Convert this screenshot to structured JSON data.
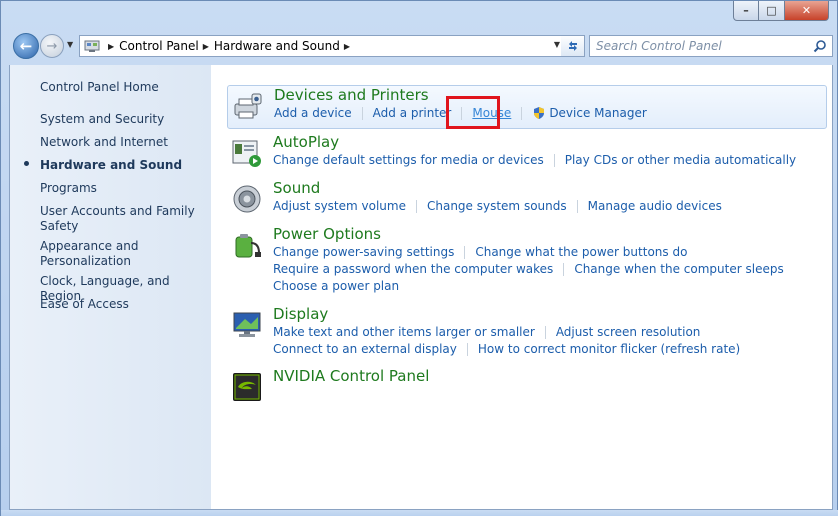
{
  "window": {
    "minimize_label": "–",
    "maximize_label": "□",
    "close_label": "✕"
  },
  "toolbar": {
    "back_glyph": "←",
    "forward_glyph": "→",
    "breadcrumbs": [
      "Control Panel",
      "Hardware and Sound"
    ],
    "search_placeholder": "Search Control Panel"
  },
  "sidebar": {
    "items": [
      {
        "label": "Control Panel Home"
      },
      {
        "label": "System and Security"
      },
      {
        "label": "Network and Internet"
      },
      {
        "label": "Hardware and Sound",
        "active": true
      },
      {
        "label": "Programs"
      },
      {
        "label": "User Accounts and Family Safety"
      },
      {
        "label": "Appearance and Personalization"
      },
      {
        "label": "Clock, Language, and Region"
      },
      {
        "label": "Ease of Access"
      }
    ]
  },
  "categories": [
    {
      "title": "Devices and Printers",
      "icon": "printer-icon",
      "rows": [
        [
          "Add a device",
          "Add a printer",
          "Mouse",
          "Device Manager"
        ]
      ]
    },
    {
      "title": "AutoPlay",
      "icon": "autoplay-icon",
      "rows": [
        [
          "Change default settings for media or devices",
          "Play CDs or other media automatically"
        ]
      ]
    },
    {
      "title": "Sound",
      "icon": "speaker-icon",
      "rows": [
        [
          "Adjust system volume",
          "Change system sounds",
          "Manage audio devices"
        ]
      ]
    },
    {
      "title": "Power Options",
      "icon": "battery-icon",
      "rows": [
        [
          "Change power-saving settings",
          "Change what the power buttons do"
        ],
        [
          "Require a password when the computer wakes",
          "Change when the computer sleeps"
        ],
        [
          "Choose a power plan"
        ]
      ]
    },
    {
      "title": "Display",
      "icon": "monitor-icon",
      "rows": [
        [
          "Make text and other items larger or smaller",
          "Adjust screen resolution"
        ],
        [
          "Connect to an external display",
          "How to correct monitor flicker (refresh rate)"
        ]
      ]
    },
    {
      "title": "NVIDIA Control Panel",
      "icon": "nvidia-icon",
      "rows": []
    }
  ],
  "colors": {
    "title_green": "#1e7a1e",
    "link_blue": "#1c5dab",
    "highlight_red": "#e0141c"
  }
}
